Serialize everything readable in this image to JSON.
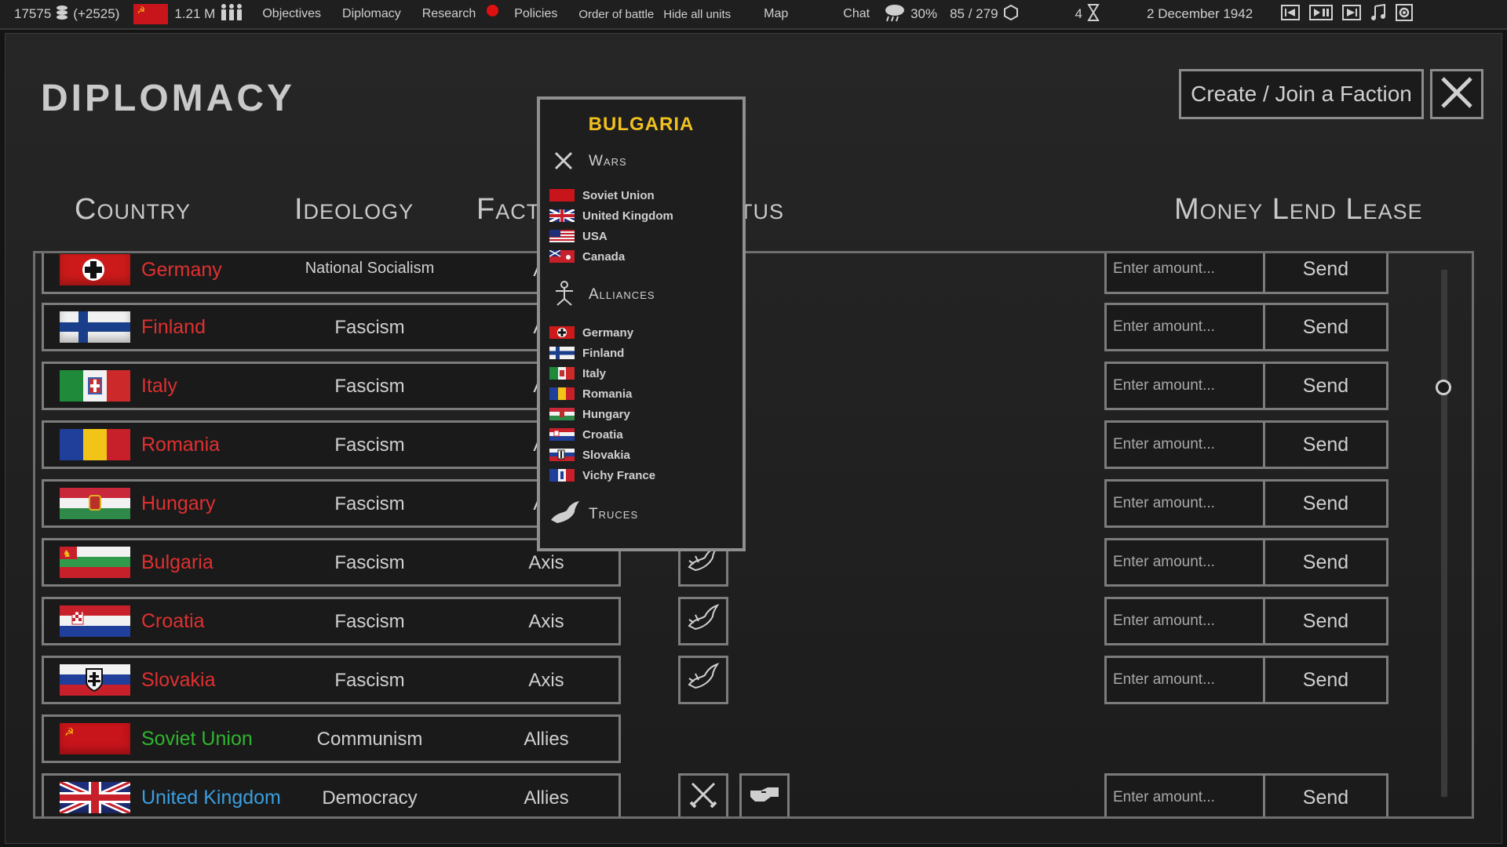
{
  "topbar": {
    "money": "17575",
    "income": "(+2525)",
    "manpower": "1.21 M",
    "menu": [
      "Objectives",
      "Diplomacy",
      "Research",
      "Policies",
      "Order of battle",
      "Hide all units",
      "Map",
      "Chat"
    ],
    "weather_percent": "30%",
    "units": "85 / 279",
    "speed": "4",
    "date": "2 December 1942"
  },
  "page": {
    "title": "DIPLOMACY",
    "faction_button": "Create / Join a Faction",
    "close_icon": "close-icon"
  },
  "columns": {
    "country": "Country",
    "ideology": "Ideology",
    "faction": "Fact",
    "status": "tus",
    "money": "Money Lend Lease"
  },
  "rows": [
    {
      "name": "Germany",
      "ideology": "National Socialism",
      "faction": "Axi",
      "status": [],
      "lend": true,
      "color": "#e03030"
    },
    {
      "name": "Finland",
      "ideology": "Fascism",
      "faction": "Axi",
      "status": [],
      "lend": true,
      "color": "#e03030"
    },
    {
      "name": "Italy",
      "ideology": "Fascism",
      "faction": "Axi",
      "status": [],
      "lend": true,
      "color": "#e03030"
    },
    {
      "name": "Romania",
      "ideology": "Fascism",
      "faction": "Axi",
      "status": [],
      "lend": true,
      "color": "#e03030"
    },
    {
      "name": "Hungary",
      "ideology": "Fascism",
      "faction": "Axi",
      "status": [],
      "lend": true,
      "color": "#e03030"
    },
    {
      "name": "Bulgaria",
      "ideology": "Fascism",
      "faction": "Axis",
      "status": [
        "dove"
      ],
      "lend": true,
      "color": "#e03030"
    },
    {
      "name": "Croatia",
      "ideology": "Fascism",
      "faction": "Axis",
      "status": [
        "dove"
      ],
      "lend": true,
      "color": "#e03030"
    },
    {
      "name": "Slovakia",
      "ideology": "Fascism",
      "faction": "Axis",
      "status": [
        "dove"
      ],
      "lend": true,
      "color": "#e03030"
    },
    {
      "name": "Soviet Union",
      "ideology": "Communism",
      "faction": "Allies",
      "status": [],
      "lend": false,
      "color": "#2fb52f"
    },
    {
      "name": "United Kingdom",
      "ideology": "Democracy",
      "faction": "Allies",
      "status": [
        "swords",
        "hand"
      ],
      "lend": true,
      "color": "#3a9ee0"
    }
  ],
  "lend": {
    "placeholder": "Enter amount...",
    "send_label": "Send"
  },
  "popup": {
    "title": "BULGARIA",
    "wars_label": "Wars",
    "wars": [
      "Soviet Union",
      "United Kingdom",
      "USA",
      "Canada"
    ],
    "alliances_label": "Alliances",
    "alliances": [
      "Germany",
      "Finland",
      "Italy",
      "Romania",
      "Hungary",
      "Croatia",
      "Slovakia",
      "Vichy France"
    ],
    "truces_label": "Truces"
  }
}
